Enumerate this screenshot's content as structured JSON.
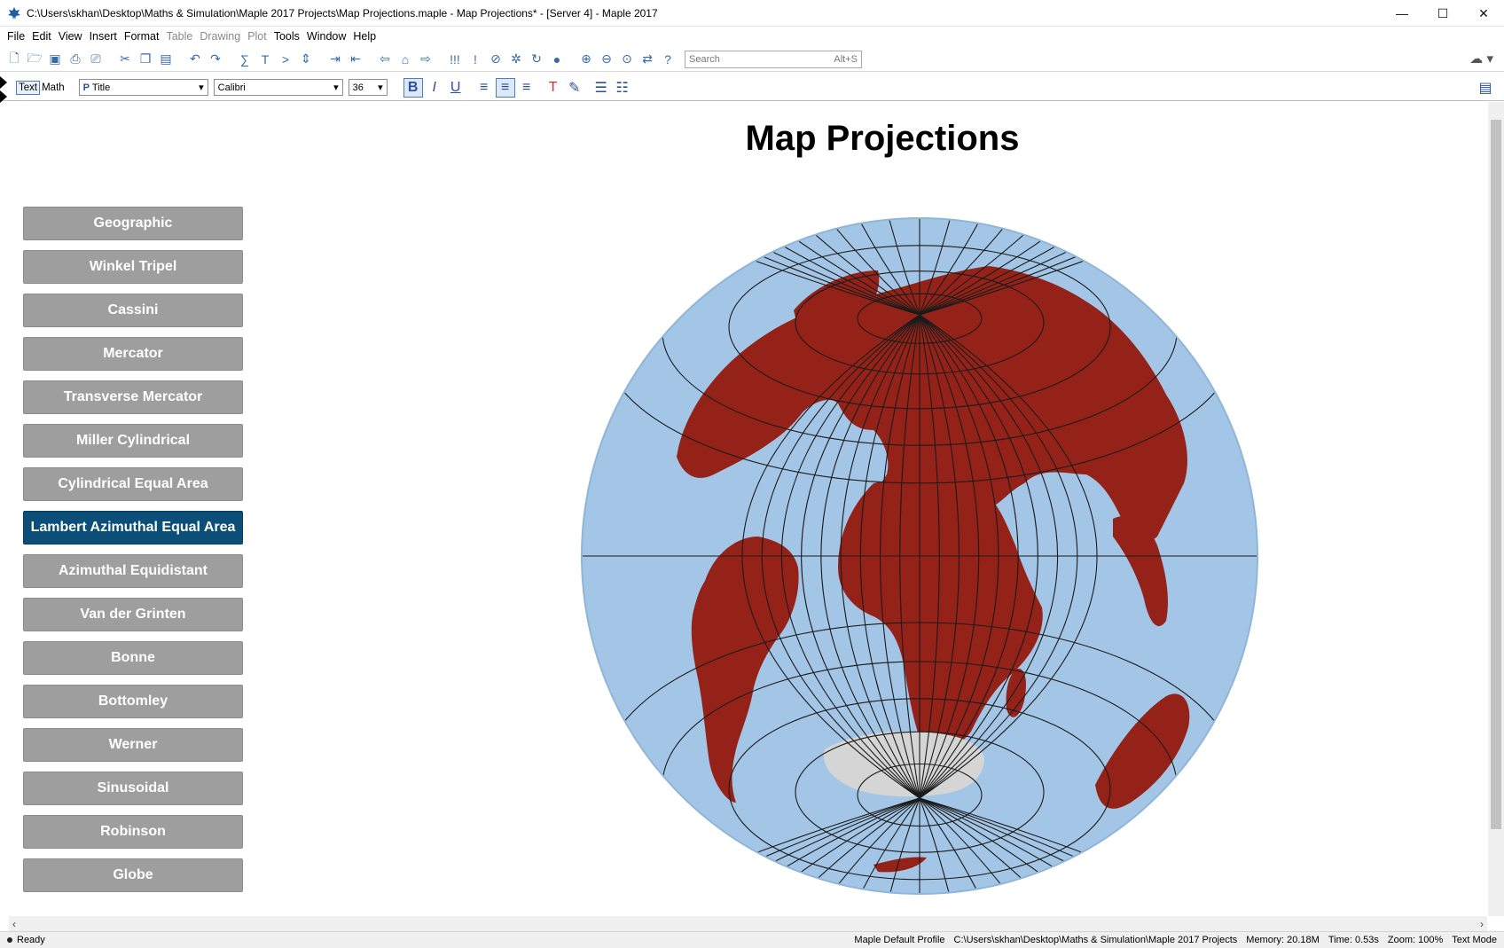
{
  "window": {
    "title": "C:\\Users\\skhan\\Desktop\\Maths & Simulation\\Maple 2017 Projects\\Map Projections.maple - Map Projections* - [Server 4] - Maple 2017",
    "minimize": "—",
    "maximize": "☐",
    "close": "✕"
  },
  "menu": {
    "items": [
      "File",
      "Edit",
      "View",
      "Insert",
      "Format",
      "Table",
      "Drawing",
      "Plot",
      "Tools",
      "Window",
      "Help"
    ]
  },
  "toolbar": {
    "search_placeholder": "Search",
    "search_shortcut": "Alt+S",
    "cloud_icon": "cloud-icon"
  },
  "formatbar": {
    "mode_text": "Text",
    "mode_math": "Math",
    "style_value": "Title",
    "font_value": "Calibri",
    "size_value": "36"
  },
  "document": {
    "title": "Map Projections",
    "buttons": [
      {
        "label": "Geographic",
        "selected": false
      },
      {
        "label": "Winkel Tripel",
        "selected": false
      },
      {
        "label": "Cassini",
        "selected": false
      },
      {
        "label": "Mercator",
        "selected": false
      },
      {
        "label": "Transverse Mercator",
        "selected": false
      },
      {
        "label": "Miller Cylindrical",
        "selected": false
      },
      {
        "label": "Cylindrical Equal Area",
        "selected": false
      },
      {
        "label": "Lambert Azimuthal Equal Area",
        "selected": true
      },
      {
        "label": "Azimuthal Equidistant",
        "selected": false
      },
      {
        "label": "Van der Grinten",
        "selected": false
      },
      {
        "label": "Bonne",
        "selected": false
      },
      {
        "label": "Bottomley",
        "selected": false
      },
      {
        "label": "Werner",
        "selected": false
      },
      {
        "label": "Sinusoidal",
        "selected": false
      },
      {
        "label": "Robinson",
        "selected": false
      },
      {
        "label": "Globe",
        "selected": false
      }
    ],
    "colors": {
      "ocean": "#a3c6e6",
      "land": "#942218",
      "ice": "#d5d5d5",
      "grid": "#1b1b1b",
      "button": "#9e9e9e",
      "button_selected": "#0b4f79"
    }
  },
  "status": {
    "state": "Ready",
    "profile": "Maple Default Profile",
    "path": "C:\\Users\\skhan\\Desktop\\Maths & Simulation\\Maple 2017 Projects",
    "memory": "Memory: 20.18M",
    "time": "Time: 0.53s",
    "zoom": "Zoom: 100%",
    "mode": "Text Mode"
  }
}
